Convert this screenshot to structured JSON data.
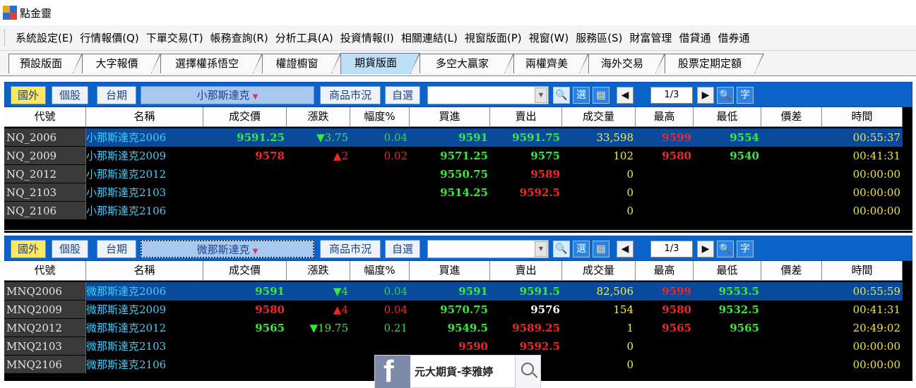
{
  "app": {
    "title": "點金靈"
  },
  "menu": [
    "系統設定(E)",
    "行情報價(Q)",
    "下單交易(T)",
    "帳務查詢(R)",
    "分析工具(A)",
    "投資情報(I)",
    "相關連結(L)",
    "視窗版面(P)",
    "視窗(W)",
    "服務區(S)",
    "財富管理",
    "借貸通",
    "借券通"
  ],
  "tabs": [
    "預設版面",
    "大字報價",
    "選擇權孫悟空",
    "權證櫥窗",
    "期貨版面",
    "多空大贏家",
    "兩權齊美",
    "海外交易",
    "股票定期定額"
  ],
  "active_tab": "期貨版面",
  "toolbar_labels": {
    "foreign": "國外",
    "stock": "個股",
    "taiex_futures": "台期",
    "market": "商品市況",
    "watchlist": "自選",
    "select": "選",
    "list": "▤",
    "prev": "◀",
    "next": "▶",
    "search_glyph": "🔍",
    "font": "字"
  },
  "columns": [
    "代號",
    "名稱",
    "成交價",
    "漲跌",
    "幅度%",
    "買進",
    "賣出",
    "成交量",
    "最高",
    "最低",
    "價差",
    "時間"
  ],
  "panels": [
    {
      "product": "小那斯達克",
      "page": "1/3",
      "rows": [
        {
          "code": "NQ_2006",
          "name": "小那斯達克2006",
          "last": "9591.25",
          "change": "▼3.75",
          "pct": "0.04",
          "bid": "9591",
          "ask": "9591.75",
          "volume": "33,598",
          "high": "9599",
          "low": "9554",
          "spread": "",
          "time": "00:55:37"
        },
        {
          "code": "NQ_2009",
          "name": "小那斯達克2009",
          "last": "9578",
          "change": "▲2",
          "pct": "0.02",
          "bid": "9571.25",
          "ask": "9575",
          "volume": "102",
          "high": "9580",
          "low": "9540",
          "spread": "",
          "time": "00:41:31"
        },
        {
          "code": "NQ_2012",
          "name": "小那斯達克2012",
          "last": "",
          "change": "",
          "pct": "",
          "bid": "9550.75",
          "ask": "9589",
          "volume": "0",
          "high": "",
          "low": "",
          "spread": "",
          "time": "00:00:00"
        },
        {
          "code": "NQ_2103",
          "name": "小那斯達克2103",
          "last": "",
          "change": "",
          "pct": "",
          "bid": "9514.25",
          "ask": "9592.5",
          "volume": "0",
          "high": "",
          "low": "",
          "spread": "",
          "time": "00:00:00"
        },
        {
          "code": "NQ_2106",
          "name": "小那斯達克2106",
          "last": "",
          "change": "",
          "pct": "",
          "bid": "",
          "ask": "",
          "volume": "0",
          "high": "",
          "low": "",
          "spread": "",
          "time": "00:00:00"
        }
      ]
    },
    {
      "product": "微那斯達克",
      "page": "1/3",
      "rows": [
        {
          "code": "MNQ2006",
          "name": "微那斯達克2006",
          "last": "9591",
          "change": "▼4",
          "pct": "0.04",
          "bid": "9591",
          "ask": "9591.5",
          "volume": "82,506",
          "high": "9599",
          "low": "9553.5",
          "spread": "",
          "time": "00:55:59"
        },
        {
          "code": "MNQ2009",
          "name": "微那斯達克2009",
          "last": "9580",
          "change": "▲4",
          "pct": "0.04",
          "bid": "9570.75",
          "ask": "9576",
          "volume": "154",
          "high": "9580",
          "low": "9532.5",
          "spread": "",
          "time": "00:41:31"
        },
        {
          "code": "MNQ2012",
          "name": "微那斯達克2012",
          "last": "9565",
          "change": "▼19.75",
          "pct": "0.21",
          "bid": "9549.5",
          "ask": "9589.25",
          "volume": "1",
          "high": "9565",
          "low": "9565",
          "spread": "",
          "time": "20:49:02"
        },
        {
          "code": "MNQ2103",
          "name": "微那斯達克2103",
          "last": "",
          "change": "",
          "pct": "",
          "bid": "9590",
          "ask": "9592.5",
          "volume": "0",
          "high": "",
          "low": "",
          "spread": "",
          "time": "00:00:00"
        },
        {
          "code": "MNQ2106",
          "name": "微那斯達克2106",
          "last": "",
          "change": "",
          "pct": "",
          "bid": "",
          "ask": "",
          "volume": "0",
          "high": "",
          "low": "",
          "spread": "",
          "time": "00:00:00"
        }
      ]
    }
  ],
  "watermark": {
    "text": "元大期貨-李雅婷",
    "logo": "f"
  },
  "colors": {
    "toolbar_blue": "#0b63c9",
    "up": "#ff2020",
    "down": "#33ee33",
    "selected_row": "#0a4a9a",
    "name": "#3ad0ff"
  }
}
